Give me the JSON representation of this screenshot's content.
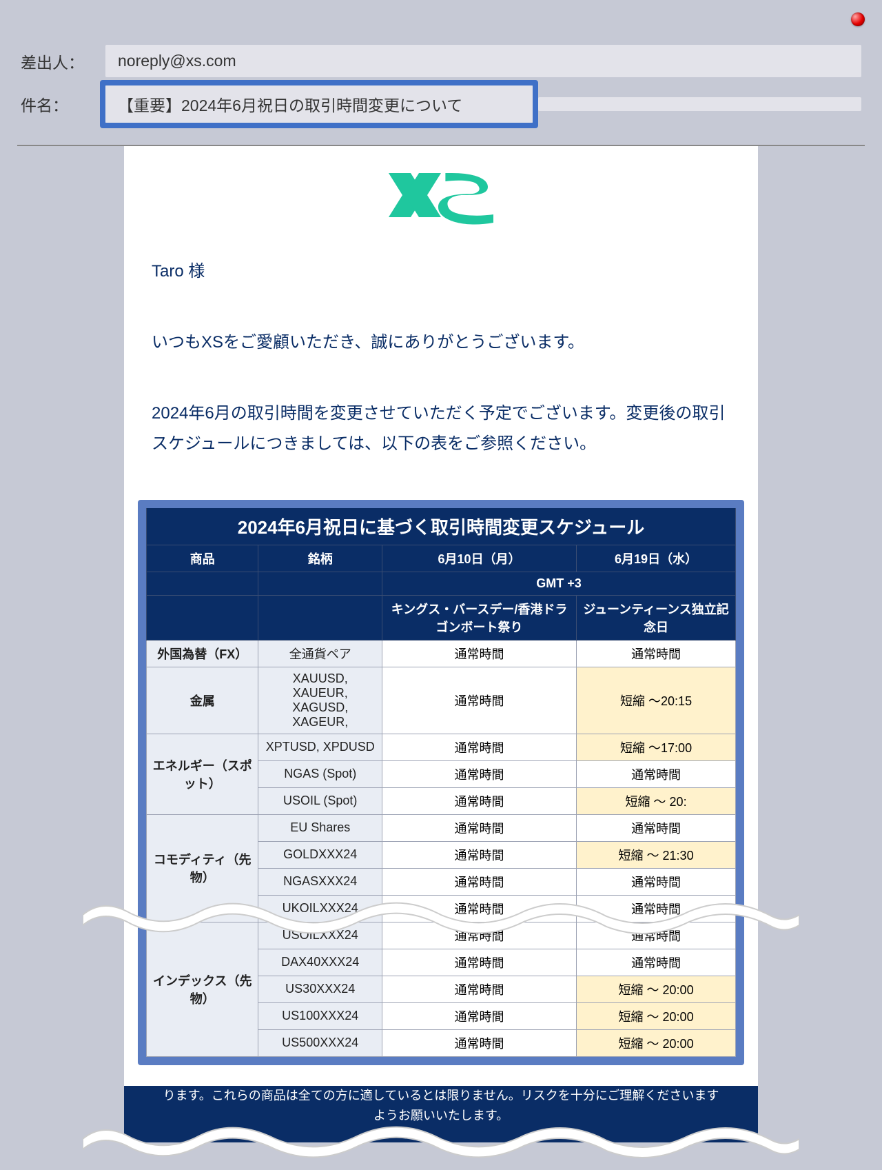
{
  "header": {
    "from_label": "差出人：",
    "from_value": "noreply@xs.com",
    "subject_label": "件名：",
    "subject_value": "【重要】2024年6月祝日の取引時間変更について"
  },
  "email": {
    "salutation": "Taro 様",
    "thanks": "いつもXSをご愛顧いただき、誠にありがとうございます。",
    "notice": "2024年6月の取引時間を変更させていただく予定でございます。変更後の取引スケジュールにつきましては、以下の表をご参照ください。"
  },
  "table": {
    "title": "2024年6月祝日に基づく取引時間変更スケジュール",
    "cols": {
      "product": "商品",
      "symbol": "銘柄",
      "jun10": "6月10日（月）",
      "jun19": "6月19日（水）"
    },
    "tz": "GMT +3",
    "events": {
      "jun10": "キングス・バースデー/香港ドラゴンボート祭り",
      "jun19": "ジューンティーンス独立記念日"
    },
    "rows": [
      {
        "product": "外国為替（FX）",
        "symbol": "全通貨ペア",
        "jun10": "通常時間",
        "jun19": "通常時間",
        "h19": false,
        "span": 1
      },
      {
        "product": "金属",
        "symbol": "XAUUSD, XAUEUR, XAGUSD, XAGEUR,",
        "jun10": "通常時間",
        "jun19": "短縮 ～20:15",
        "h19": true,
        "span": 1
      },
      {
        "product": "エネルギー（スポット）",
        "symbol": "XPTUSD, XPDUSD",
        "jun10": "通常時間",
        "jun19": "短縮 ～17:00",
        "h19": true,
        "span": 3
      },
      {
        "symbol": "NGAS (Spot)",
        "jun10": "通常時間",
        "jun19": "通常時間",
        "h19": false
      },
      {
        "symbol": "USOIL (Spot)",
        "jun10": "通常時間",
        "jun19": "短縮 ～ 20:",
        "h19": true
      },
      {
        "product": "コモディティ（先物）",
        "symbol": "EU Shares",
        "jun10": "通常時間",
        "jun19": "通常時間",
        "h19": false,
        "span": 4
      },
      {
        "symbol": "GOLDXXX24",
        "jun10": "通常時間",
        "jun19": "短縮 ～ 21:30",
        "h19": true
      },
      {
        "symbol": "NGASXXX24",
        "jun10": "通常時間",
        "jun19": "通常時間",
        "h19": false
      },
      {
        "symbol": "UKOILXXX24",
        "jun10": "通常時間",
        "jun19": "通常時間",
        "h19": false
      },
      {
        "product": "インデックス（先物）",
        "symbol": "USOILXXX24",
        "jun10": "通常時間",
        "jun19": "通常時間",
        "h19": false,
        "span": 5
      },
      {
        "symbol": "DAX40XXX24",
        "jun10": "通常時間",
        "jun19": "通常時間",
        "h19": false
      },
      {
        "symbol": "US30XXX24",
        "jun10": "通常時間",
        "jun19": "短縮 ～ 20:00",
        "h19": true
      },
      {
        "symbol": "US100XXX24",
        "jun10": "通常時間",
        "jun19": "短縮 ～ 20:00",
        "h19": true
      },
      {
        "symbol": "US500XXX24",
        "jun10": "通常時間",
        "jun19": "短縮 ～ 20:00",
        "h19": true
      }
    ]
  },
  "footer": {
    "text": "ります。これらの商品は全ての方に適しているとは限りません。リスクを十分にご理解くださいますようお願いいたします。"
  }
}
